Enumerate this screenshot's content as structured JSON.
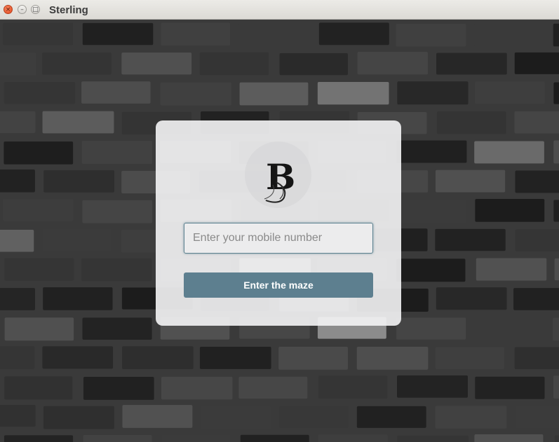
{
  "window": {
    "title": "Sterling",
    "controls": {
      "close": "×",
      "minimize": "–",
      "maximize": "□"
    }
  },
  "login": {
    "logo_letter": "B",
    "mobile_placeholder": "Enter your mobile number",
    "mobile_value": "",
    "submit_label": "Enter the maze"
  },
  "colors": {
    "accent": "#5d7f8f",
    "card": "#f3f3f4",
    "mortar": "#3a3a3a",
    "brick": "#2b2b2b"
  },
  "icons": [
    "close-icon",
    "minimize-icon",
    "maximize-icon",
    "brand-logo-icon"
  ]
}
